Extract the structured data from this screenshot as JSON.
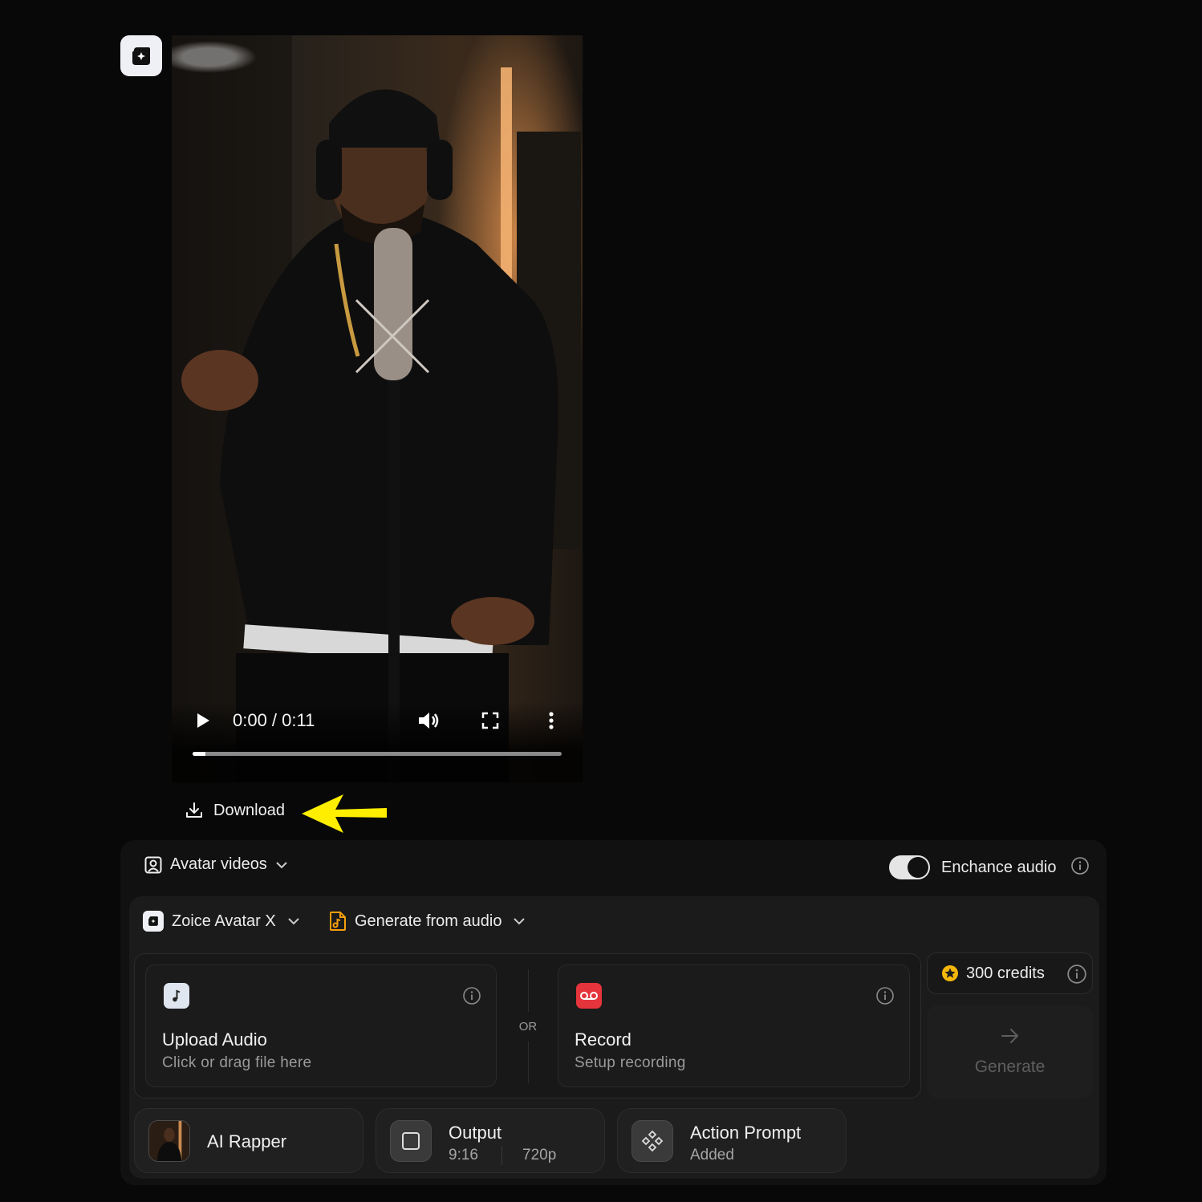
{
  "video": {
    "time": "0:00 / 0:11",
    "progress_fraction": 0.035
  },
  "download": {
    "label": "Download"
  },
  "mode": {
    "label": "Avatar videos"
  },
  "enhance": {
    "label": "Enchance audio",
    "enabled": true
  },
  "model": {
    "label": "Zoice Avatar X"
  },
  "source": {
    "label": "Generate from audio"
  },
  "upload": {
    "title": "Upload Audio",
    "subtitle": "Click or drag file here"
  },
  "divider": {
    "or": "OR"
  },
  "record": {
    "title": "Record",
    "subtitle": "Setup recording"
  },
  "credits": {
    "label": "300 credits"
  },
  "generate": {
    "label": "Generate"
  },
  "avatar_chip": {
    "label": "AI Rapper"
  },
  "output_chip": {
    "label": "Output",
    "ratio": "9:16",
    "resolution": "720p"
  },
  "action_chip": {
    "label": "Action Prompt",
    "status": "Added"
  },
  "colors": {
    "accent_yellow": "#ffee00",
    "record_red": "#e5343c",
    "credit_gold": "#f5b70a"
  }
}
